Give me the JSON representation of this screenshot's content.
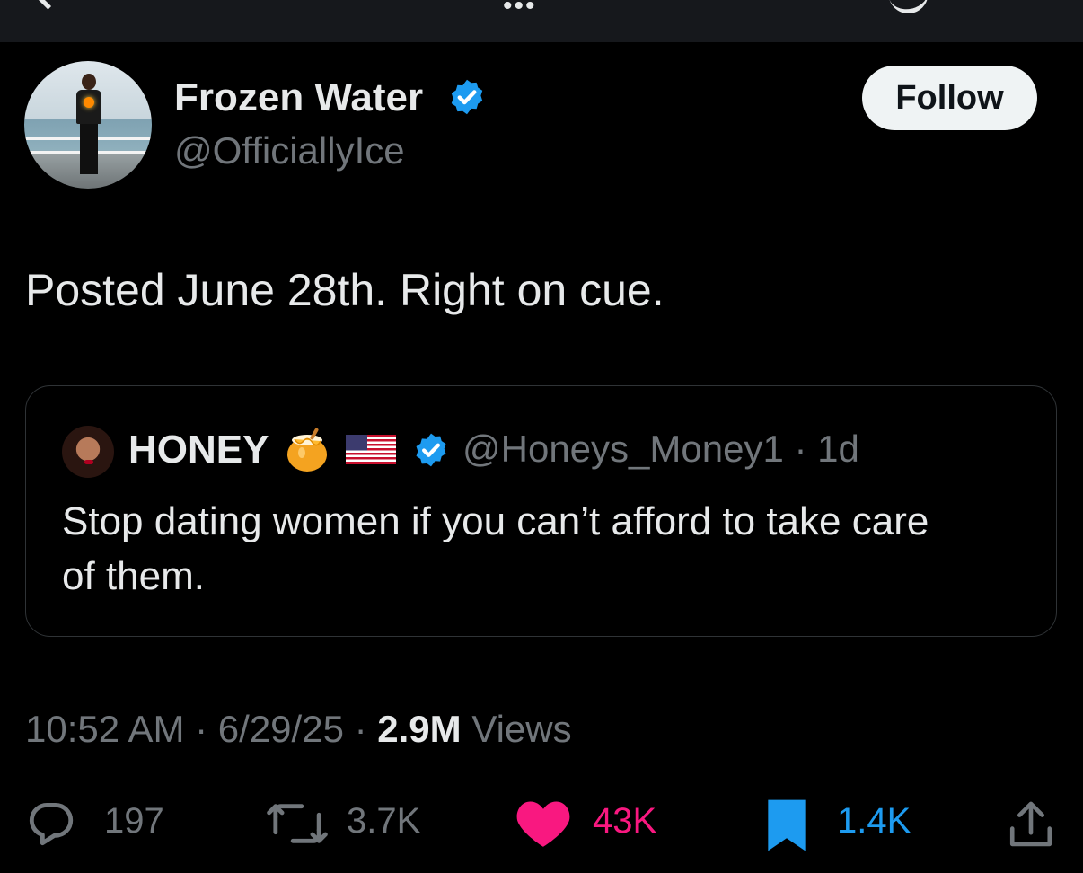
{
  "author": {
    "name": "Frozen Water",
    "handle": "@OfficiallyIce",
    "verified": true
  },
  "follow_label": "Follow",
  "tweet_text": "Posted June 28th. Right on cue.",
  "quoted": {
    "name": "HONEY",
    "emoji": [
      "honey-pot",
      "us-flag"
    ],
    "verified": true,
    "handle": "@Honeys_Money1",
    "age": "1d",
    "text": "Stop dating women if you can’t afford to take care of them."
  },
  "meta": {
    "time": "10:52 AM",
    "date": "6/29/25",
    "views_count": "2.9M",
    "views_label": "Views"
  },
  "actions": {
    "replies": "197",
    "reposts": "3.7K",
    "likes": "43K",
    "bookmarks": "1.4K"
  },
  "colors": {
    "background": "#000000",
    "text": "#e7e9ea",
    "muted": "#71767b",
    "verified_blue": "#1d9bf0",
    "like_pink": "#f91880",
    "bookmark_blue": "#1d9bf0",
    "border": "#2f3336"
  },
  "icons": [
    "back-arrow-icon",
    "more-icon",
    "grok-icon",
    "verified-badge-icon",
    "reply-icon",
    "repost-icon",
    "like-icon",
    "bookmark-icon",
    "share-icon"
  ]
}
